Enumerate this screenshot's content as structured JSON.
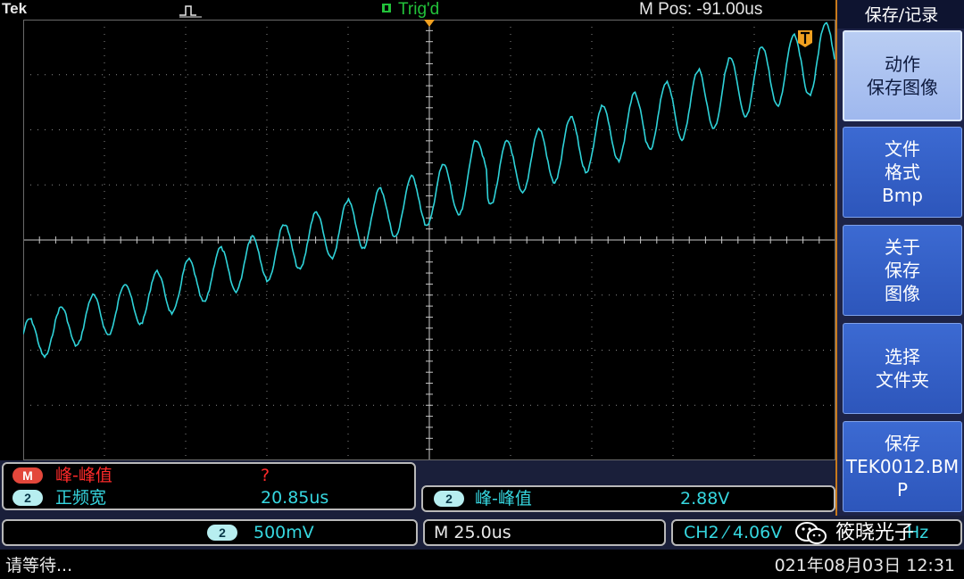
{
  "top": {
    "brand": "Tek",
    "trigger_state": "Trig'd",
    "horizontal_position": "M Pos: -91.00us"
  },
  "side_menu": {
    "title": "保存/记录",
    "buttons": [
      {
        "lines": [
          "动作",
          "保存图像"
        ]
      },
      {
        "lines": [
          "文件",
          "格式",
          "Bmp"
        ]
      },
      {
        "lines": [
          "关于",
          "保存",
          "图像"
        ]
      },
      {
        "lines": [
          "选择",
          "文件夹"
        ]
      },
      {
        "lines": [
          "保存",
          "TEK0012.BM",
          "P"
        ]
      }
    ]
  },
  "measurements": {
    "math": {
      "badge": "M",
      "label": "峰-峰值",
      "value": "?"
    },
    "ch2_pos_width": {
      "badge": "2",
      "label": "正频宽",
      "value": "20.85us"
    },
    "ch2_pk_pk": {
      "badge": "2",
      "label": "峰-峰值",
      "value": "2.88V"
    }
  },
  "bottom": {
    "ch2_badge": "2",
    "ch2_scale": "500mV",
    "timebase": "M 25.0us",
    "trigger": "CH2 ⁄ 4.06V",
    "trigger_freq_suffix": "Hz",
    "status_text": "请等待...",
    "datetime": "021年08月03日 12:31",
    "watermark": "筱晓光子"
  },
  "colors": {
    "trace": "#2fd3d9",
    "grid": "#8a8a8a",
    "trigger_marker": "#f0a020",
    "accent": "#c87a1c"
  },
  "icons": [
    "pulse-icon",
    "trigger-marker-icon",
    "wechat-icon"
  ]
}
